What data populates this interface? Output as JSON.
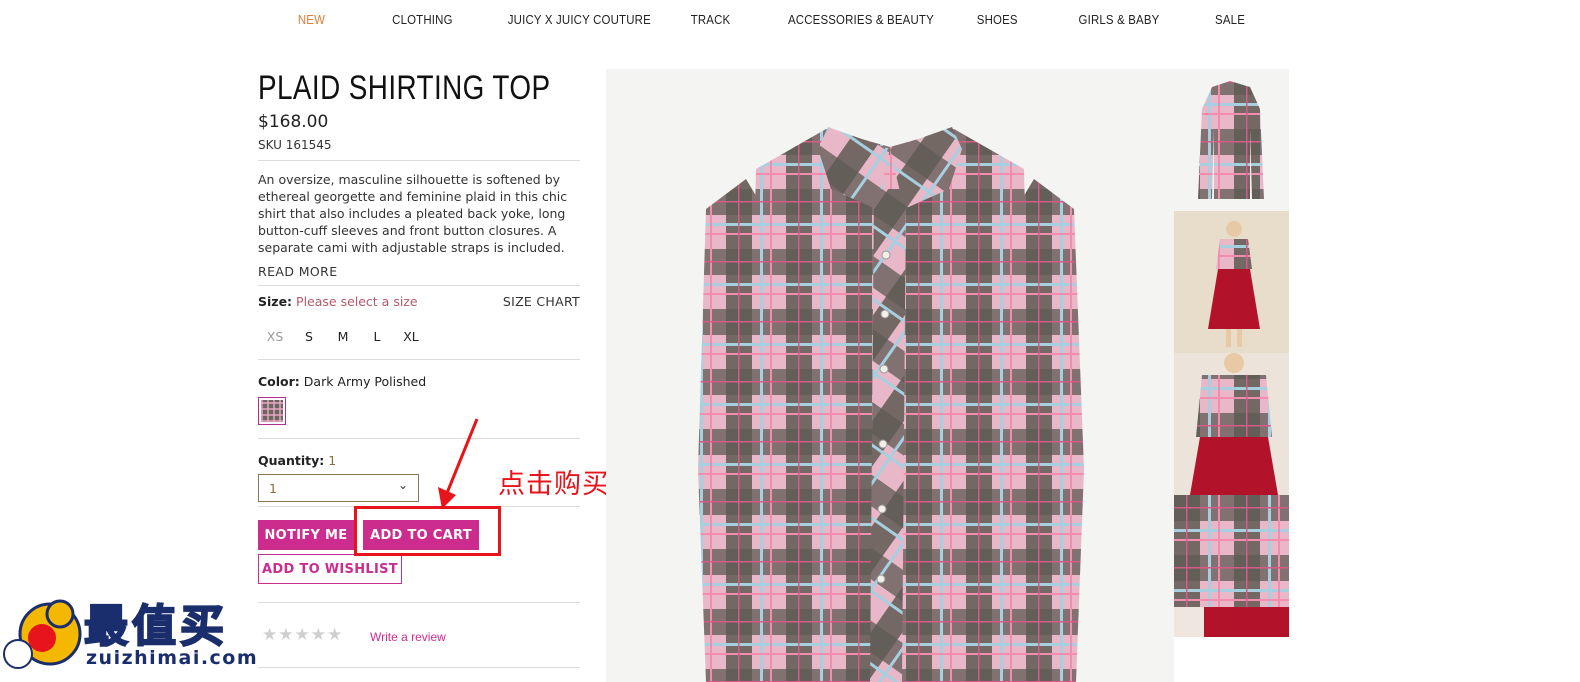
{
  "nav": {
    "items": [
      {
        "label": "NEW",
        "active": true
      },
      {
        "label": "CLOTHING"
      },
      {
        "label": "JUICY X JUICY COUTURE"
      },
      {
        "label": "TRACK"
      },
      {
        "label": "ACCESSORIES & BEAUTY"
      },
      {
        "label": "SHOES"
      },
      {
        "label": "GIRLS & BABY"
      },
      {
        "label": "SALE"
      }
    ]
  },
  "product": {
    "title": "PLAID SHIRTING TOP",
    "price": "$168.00",
    "sku": "SKU 161545",
    "description": "An oversize, masculine silhouette is softened by ethereal georgette and feminine plaid in this chic shirt that also includes a pleated back yoke, long button-cuff sleeves and front button closures. A separate cami with adjustable straps is included.",
    "read_more": "READ MORE",
    "size": {
      "label": "Size:",
      "hint": "Please select a size",
      "chart_link": "SIZE CHART",
      "options": [
        "XS",
        "S",
        "M",
        "L",
        "XL"
      ]
    },
    "color": {
      "label": "Color:",
      "value": "Dark Army Polished"
    },
    "quantity": {
      "label": "Quantity:",
      "value": "1",
      "selected": "1"
    },
    "buttons": {
      "notify": "NOTIFY ME",
      "add_to_cart": "ADD TO CART",
      "wishlist": "ADD TO WISHLIST"
    },
    "reviews": {
      "stars": "★★★★★",
      "write": "Write a review"
    }
  },
  "annotation": {
    "callout": "点击购买"
  },
  "watermark": {
    "text": "最值买",
    "url": "zuizhimai.com"
  },
  "colors": {
    "brand_pink": "#cc2c8e",
    "nav_active": "#e07b39",
    "annotation_red": "#e8141b"
  }
}
